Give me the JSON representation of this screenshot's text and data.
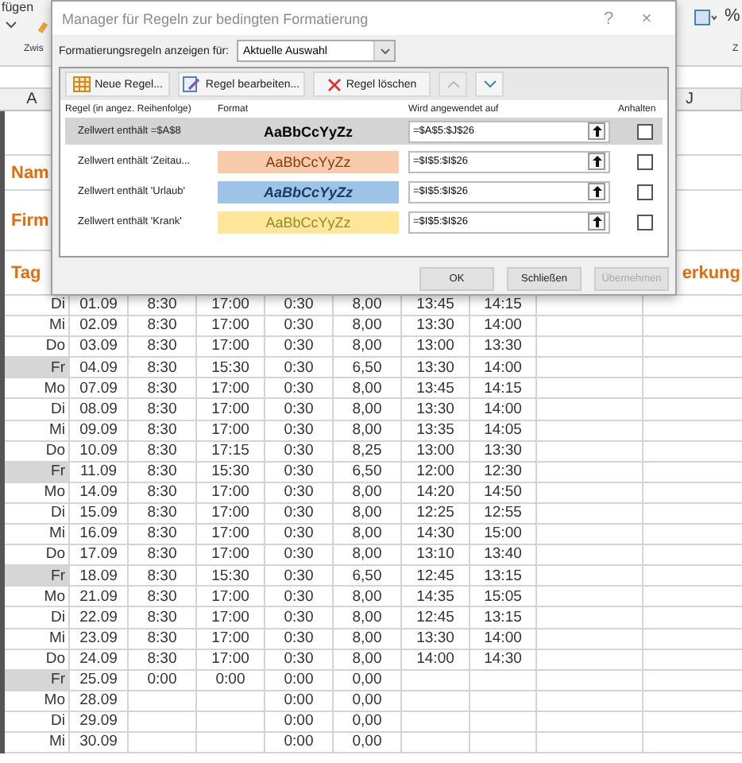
{
  "ribbon": {
    "texts": [
      "fügen",
      "Zwis",
      "Z",
      "%"
    ]
  },
  "sheet": {
    "column_headers": [
      "A",
      "J"
    ],
    "labels": [
      {
        "text": "Nam"
      },
      {
        "text": "Firm"
      },
      {
        "text": "Tag"
      }
    ],
    "header_right": "erkung",
    "rows": [
      {
        "day": "Di",
        "highlighted": false,
        "cells": [
          "01.09",
          "8:30",
          "17:00",
          "0:30",
          "8,00",
          "13:45",
          "14:15"
        ]
      },
      {
        "day": "Mi",
        "highlighted": false,
        "cells": [
          "02.09",
          "8:30",
          "17:00",
          "0:30",
          "8,00",
          "13:30",
          "14:00"
        ]
      },
      {
        "day": "Do",
        "highlighted": false,
        "cells": [
          "03.09",
          "8:30",
          "17:00",
          "0:30",
          "8,00",
          "13:00",
          "13:30"
        ]
      },
      {
        "day": "Fr",
        "highlighted": true,
        "cells": [
          "04.09",
          "8:30",
          "15:30",
          "0:30",
          "6,50",
          "13:30",
          "14:00"
        ]
      },
      {
        "day": "Mo",
        "highlighted": false,
        "cells": [
          "07.09",
          "8:30",
          "17:00",
          "0:30",
          "8,00",
          "13:45",
          "14:15"
        ]
      },
      {
        "day": "Di",
        "highlighted": false,
        "cells": [
          "08.09",
          "8:30",
          "17:00",
          "0:30",
          "8,00",
          "13:30",
          "14:00"
        ]
      },
      {
        "day": "Mi",
        "highlighted": false,
        "cells": [
          "09.09",
          "8:30",
          "17:00",
          "0:30",
          "8,00",
          "13:35",
          "14:05"
        ]
      },
      {
        "day": "Do",
        "highlighted": false,
        "cells": [
          "10.09",
          "8:30",
          "17:15",
          "0:30",
          "8,25",
          "13:00",
          "13:30"
        ]
      },
      {
        "day": "Fr",
        "highlighted": true,
        "cells": [
          "11.09",
          "8:30",
          "15:30",
          "0:30",
          "6,50",
          "12:00",
          "12:30"
        ]
      },
      {
        "day": "Mo",
        "highlighted": false,
        "cells": [
          "14.09",
          "8:30",
          "17:00",
          "0:30",
          "8,00",
          "14:20",
          "14:50"
        ]
      },
      {
        "day": "Di",
        "highlighted": false,
        "cells": [
          "15.09",
          "8:30",
          "17:00",
          "0:30",
          "8,00",
          "12:25",
          "12:55"
        ]
      },
      {
        "day": "Mi",
        "highlighted": false,
        "cells": [
          "16.09",
          "8:30",
          "17:00",
          "0:30",
          "8,00",
          "14:30",
          "15:00"
        ]
      },
      {
        "day": "Do",
        "highlighted": false,
        "cells": [
          "17.09",
          "8:30",
          "17:00",
          "0:30",
          "8,00",
          "13:10",
          "13:40"
        ]
      },
      {
        "day": "Fr",
        "highlighted": true,
        "cells": [
          "18.09",
          "8:30",
          "15:30",
          "0:30",
          "6,50",
          "12:45",
          "13:15"
        ]
      },
      {
        "day": "Mo",
        "highlighted": false,
        "cells": [
          "21.09",
          "8:30",
          "17:00",
          "0:30",
          "8,00",
          "14:35",
          "15:05"
        ]
      },
      {
        "day": "Di",
        "highlighted": false,
        "cells": [
          "22.09",
          "8:30",
          "17:00",
          "0:30",
          "8,00",
          "12:45",
          "13:15"
        ]
      },
      {
        "day": "Mi",
        "highlighted": false,
        "cells": [
          "23.09",
          "8:30",
          "17:00",
          "0:30",
          "8,00",
          "13:30",
          "14:00"
        ]
      },
      {
        "day": "Do",
        "highlighted": false,
        "cells": [
          "24.09",
          "8:30",
          "17:00",
          "0:30",
          "8,00",
          "14:00",
          "14:30"
        ]
      },
      {
        "day": "Fr",
        "highlighted": true,
        "cells": [
          "25.09",
          "0:00",
          "0:00",
          "0:00",
          "0,00",
          "",
          ""
        ]
      },
      {
        "day": "Mo",
        "highlighted": false,
        "cells": [
          "28.09",
          "",
          "",
          "0:00",
          "0,00",
          "",
          ""
        ]
      },
      {
        "day": "Di",
        "highlighted": false,
        "cells": [
          "29.09",
          "",
          "",
          "0:00",
          "0,00",
          "",
          ""
        ]
      },
      {
        "day": "Mi",
        "highlighted": false,
        "cells": [
          "30.09",
          "",
          "",
          "0:00",
          "0,00",
          "",
          ""
        ]
      }
    ]
  },
  "dialog": {
    "title": "Manager für Regeln zur bedingten Formatierung",
    "help": "?",
    "close": "×",
    "show_rules_for": {
      "label": "Formatierungsregeln anzeigen für:",
      "value": "Aktuelle Auswahl"
    },
    "toolbar": [
      {
        "kind": "new",
        "label": "Neue Regel...",
        "disabled": false
      },
      {
        "kind": "edit",
        "label": "Regel bearbeiten...",
        "disabled": false
      },
      {
        "kind": "delete",
        "label": "Regel löschen",
        "disabled": false
      },
      {
        "kind": "up",
        "disabled": true
      },
      {
        "kind": "down",
        "disabled": false
      }
    ],
    "columns": [
      "Regel (in angez. Reihenfolge)",
      "Format",
      "Wird angewendet auf",
      "Anhalten"
    ],
    "rules": [
      {
        "rule": "Zellwert enthält =$A$8",
        "preview": "AaBbCcYyZz",
        "kind": "bold",
        "color": "#d4d4d4",
        "applies_to": "=$A$5:$J$26",
        "stop": false,
        "selected": true
      },
      {
        "rule": "Zellwert enthält 'Zeitau...",
        "preview": "AaBbCcYyZz",
        "kind": "peach",
        "color": "#f8cbad",
        "applies_to": "=$I$5:$I$26",
        "stop": false,
        "selected": false
      },
      {
        "rule": "Zellwert enthält 'Urlaub'",
        "preview": "AaBbCcYyZz",
        "kind": "navy",
        "color": "#9dc3e6",
        "applies_to": "=$I$5:$I$26",
        "stop": false,
        "selected": false
      },
      {
        "rule": "Zellwert enthält 'Krank'",
        "preview": "AaBbCcYyZz",
        "kind": "olive",
        "color": "#ffe699",
        "applies_to": "=$I$5:$I$26",
        "stop": false,
        "selected": false
      }
    ],
    "buttons": [
      {
        "label": "OK",
        "disabled": false
      },
      {
        "label": "Schließen",
        "disabled": false
      },
      {
        "label": "Übernehmen",
        "disabled": true
      }
    ]
  }
}
